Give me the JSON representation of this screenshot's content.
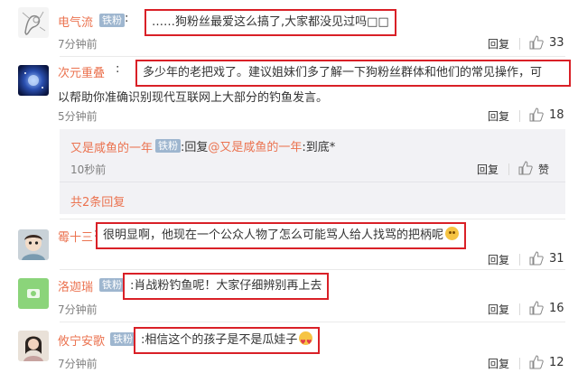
{
  "comments": [
    {
      "username": "电气流",
      "badge": "铁粉",
      "text": "……狗粉丝最爱这么搞了,大家都没见过吗□□",
      "time": "7分钟前",
      "reply_label": "回复",
      "likes": "33"
    },
    {
      "username": "次元重叠",
      "badge": "",
      "text_line1": "多少年的老把戏了",
      "text_line1b": "。建议姐妹们多了解一下狗粉丝群体和他们的常见操作，可",
      "text_line2": "以帮助你准确识别现代互联网上大部分的钓鱼发言。",
      "time": "5分钟前",
      "reply_label": "回复",
      "likes": "18",
      "sub_reply": {
        "username": "又是咸鱼的一年",
        "badge": "铁粉",
        "text_prefix": "回复",
        "mention": "@又是咸鱼的一年",
        "text_suffix": ":到底*",
        "time": "10秒前",
        "reply_label": "回复",
        "like_label": "赞"
      },
      "more_replies": "共2条回复"
    },
    {
      "username": "霉十三",
      "badge": "",
      "text": "很明显啊，他现在一个公众人物了怎么可能骂人给人找骂的把柄呢",
      "time": "",
      "reply_label": "回复",
      "likes": "31"
    },
    {
      "username": "洛迦瑞",
      "badge": "铁粉",
      "text": "肖战粉钓鱼呢！大家仔细辨别再上去",
      "time": "7分钟前",
      "reply_label": "回复",
      "likes": "16"
    },
    {
      "username": "攸宁安歌",
      "badge": "铁粉",
      "text": "相信这个的孩子是不是瓜娃子",
      "time": "7分钟前",
      "reply_label": "回复",
      "likes": "12"
    }
  ]
}
